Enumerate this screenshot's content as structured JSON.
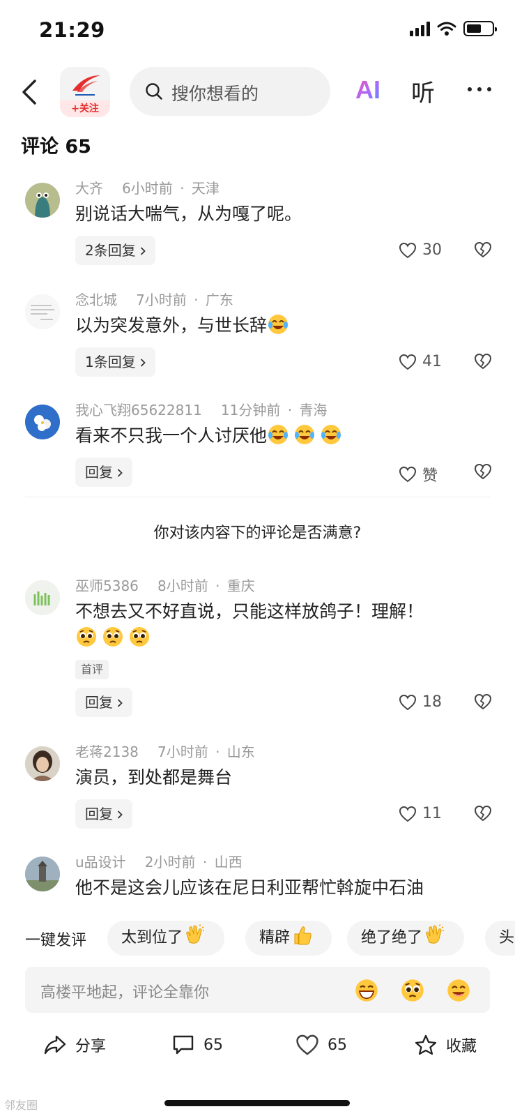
{
  "status_bar": {
    "time": "21:29"
  },
  "nav": {
    "follow_label": "+关注",
    "search_placeholder": "搜你想看的",
    "ai_label": "AI",
    "listen_label": "听"
  },
  "comments_header": {
    "title": "评论 65"
  },
  "comments": [
    {
      "user": "大齐",
      "time": "6小时前",
      "location": "天津",
      "text": "别说话大喘气，从为嘎了呢。",
      "reply": "2条回复",
      "likes": "30"
    },
    {
      "user": "念北城",
      "time": "7小时前",
      "location": "广东",
      "text": "以为突发意外，与世长辞",
      "reply": "1条回复",
      "likes": "41"
    },
    {
      "user": "我心飞翔65622811",
      "time": "11分钟前",
      "location": "青海",
      "text": "看来不只我一个人讨厌他",
      "reply": "回复",
      "likes": "赞"
    },
    {
      "user": "巫师5386",
      "time": "8小时前",
      "location": "重庆",
      "text": "不想去又不好直说，只能这样放鸽子！理解！",
      "badge": "首评",
      "reply": "回复",
      "likes": "18"
    },
    {
      "user": "老蒋2138",
      "time": "7小时前",
      "location": "山东",
      "text": "演员，到处都是舞台",
      "reply": "回复",
      "likes": "11"
    },
    {
      "user": "u品设计",
      "time": "2小时前",
      "location": "山西",
      "text": "他不是这会儿应该在尼日利亚帮忙斡旋中石油"
    }
  ],
  "survey": {
    "question": "你对该内容下的评论是否满意?"
  },
  "quick_comments": {
    "label": "一键发评",
    "chips": [
      "太到位了",
      "精辟",
      "绝了绝了",
      "头"
    ]
  },
  "input": {
    "placeholder": "高楼平地起，评论全靠你"
  },
  "toolbar": {
    "share": "分享",
    "comments": "65",
    "likes": "65",
    "favorite": "收藏"
  },
  "watermark": "邻友圈",
  "colors": {
    "accent_red": "#e62c2c",
    "emoji_yellow": "#ffc83d",
    "chip_bg": "#f4f4f4"
  }
}
